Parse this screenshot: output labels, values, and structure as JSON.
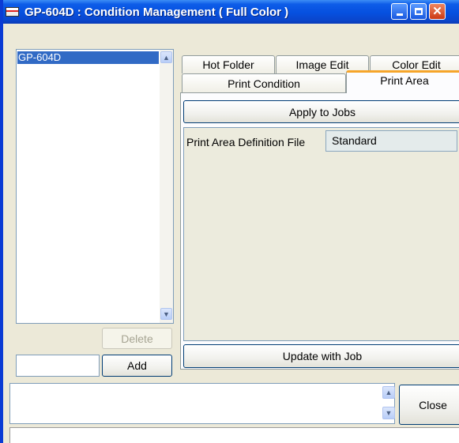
{
  "window": {
    "title": "GP-604D : Condition Management ( Full Color )"
  },
  "conditions": {
    "items": [
      "GP-604D"
    ]
  },
  "left_buttons": {
    "delete_label": "Delete",
    "add_label": "Add"
  },
  "tabs": {
    "row1": [
      "Hot Folder",
      "Image Edit",
      "Color Edit"
    ],
    "row2": [
      "Print Condition",
      "Print Area"
    ],
    "active": "Print Area"
  },
  "print_area": {
    "apply_label": "Apply to Jobs",
    "definition_label": "Print Area Definition File",
    "definition_value": "Standard",
    "update_label": "Update with Job"
  },
  "footer": {
    "close_label": "Close"
  },
  "icons": {
    "app": "printer-icon",
    "minimize": "minimize-icon",
    "maximize": "maximize-icon",
    "close": "close-icon",
    "scroll_up": "chevron-up-icon",
    "scroll_down": "chevron-down-icon"
  },
  "colors": {
    "titlebar": "#0a50df",
    "selection": "#316ac5",
    "active_tab_accent": "#f6a52a"
  }
}
